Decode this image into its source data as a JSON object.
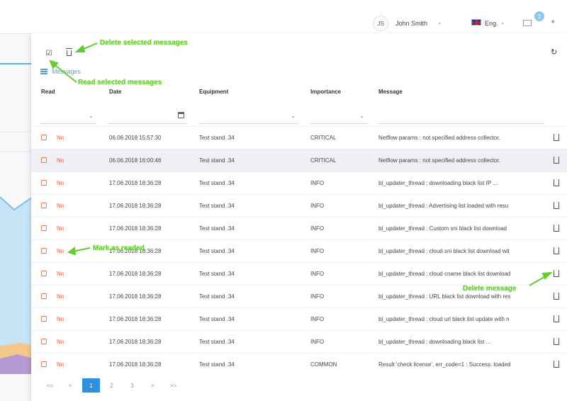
{
  "topbar": {
    "avatar_initials": "JS",
    "username": "John Smith",
    "language": "Eng.",
    "notification_count": "2"
  },
  "panel": {
    "tab_label": "Messages",
    "columns": [
      "Read",
      "Date",
      "Equipment",
      "Importance",
      "Message"
    ]
  },
  "rows": [
    {
      "read": "No",
      "date": "06.06.2018 15:57:30",
      "equipment": "Test stand .34",
      "importance": "CRITICAL",
      "message": "Netflow params : not specified address collector."
    },
    {
      "read": "No",
      "date": "06.06.2018 16:00:46",
      "equipment": "Test stand .34",
      "importance": "CRITICAL",
      "message": "Netflow params : not specified address collector."
    },
    {
      "read": "No",
      "date": "17.06.2018 18:36:28",
      "equipment": "Test stand .34",
      "importance": "INFO",
      "message": "bl_updater_thread : downloading black list IP ..."
    },
    {
      "read": "No",
      "date": "17.06.2018 18:36:28",
      "equipment": "Test stand .34",
      "importance": "INFO",
      "message": "bl_updater_thread : Advertising list loaded with resu"
    },
    {
      "read": "No",
      "date": "17.06.2018 18:36:28",
      "equipment": "Test stand .34",
      "importance": "INFO",
      "message": "bl_updater_thread : Custom sni black list download"
    },
    {
      "read": "No",
      "date": "17.06.2018 18:36:28",
      "equipment": "Test stand .34",
      "importance": "INFO",
      "message": "bl_updater_thread : cloud sni black list download wit"
    },
    {
      "read": "No",
      "date": "17.06.2018 18:36:28",
      "equipment": "Test stand .34",
      "importance": "INFO",
      "message": "bl_updater_thread : cloud cname black list download"
    },
    {
      "read": "No",
      "date": "17.06.2018 18:36:28",
      "equipment": "Test stand .34",
      "importance": "INFO",
      "message": "bl_updater_thread : URL black list download with res"
    },
    {
      "read": "No",
      "date": "17.06.2018 18:36:28",
      "equipment": "Test stand .34",
      "importance": "INFO",
      "message": "bl_updater_thread : cloud url black list update with n"
    },
    {
      "read": "No",
      "date": "17.06.2018 18:36:28",
      "equipment": "Test stand .34",
      "importance": "INFO",
      "message": "bl_updater_thread : downloading black list ..."
    },
    {
      "read": "No",
      "date": "17.06.2018 18:36:28",
      "equipment": "Test stand .34",
      "importance": "COMMON",
      "message": "Result 'check license', err_code=1 : Success: loaded"
    }
  ],
  "pagination": {
    "first": "<<",
    "prev": "<",
    "pages": [
      "1",
      "2",
      "3"
    ],
    "current_page": "1",
    "next": ">",
    "last": ">>"
  },
  "annotations": {
    "delete_selected": "Delete selected messages",
    "read_selected": "Read selected messages",
    "mark_as_readed": "Mark as readed",
    "delete_message": "Delete message"
  },
  "colors": {
    "accent": "#2e8fe0",
    "unread": "#e8613a",
    "annotation": "#5fcf2b"
  },
  "icons": {
    "read_selected": "check-square-icon",
    "delete_selected": "trash-icon",
    "refresh": "refresh-icon",
    "tab": "list-icon",
    "mail": "mail-icon",
    "pin": "pin-icon"
  }
}
